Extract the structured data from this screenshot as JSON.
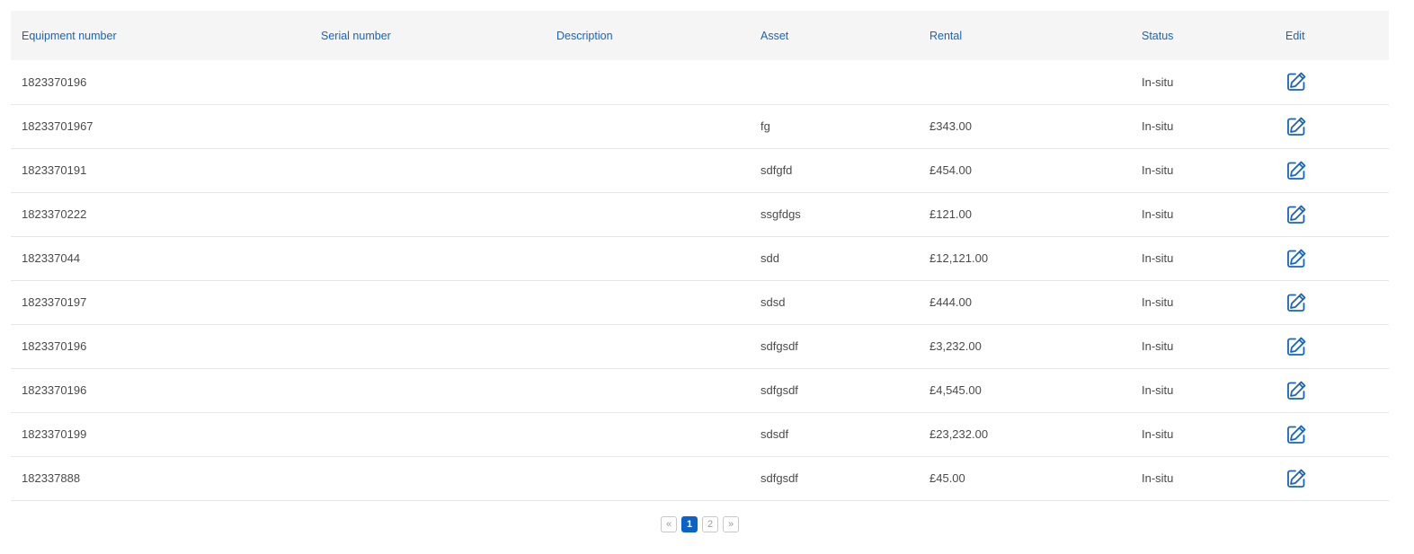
{
  "table": {
    "headers": {
      "equipment_number": "Equipment number",
      "serial_number": "Serial number",
      "description": "Description",
      "asset": "Asset",
      "rental": "Rental",
      "status": "Status",
      "edit": "Edit"
    },
    "rows": [
      {
        "equipment_number": "1823370196",
        "serial_number": "",
        "description": "",
        "asset": "",
        "rental": "",
        "status": "In-situ"
      },
      {
        "equipment_number": "18233701967",
        "serial_number": "",
        "description": "",
        "asset": "fg",
        "rental": "£343.00",
        "status": "In-situ"
      },
      {
        "equipment_number": "1823370191",
        "serial_number": "",
        "description": "",
        "asset": "sdfgfd",
        "rental": "£454.00",
        "status": "In-situ"
      },
      {
        "equipment_number": "1823370222",
        "serial_number": "",
        "description": "",
        "asset": "ssgfdgs",
        "rental": "£121.00",
        "status": "In-situ"
      },
      {
        "equipment_number": "182337044",
        "serial_number": "",
        "description": "",
        "asset": "sdd",
        "rental": "£12,121.00",
        "status": "In-situ"
      },
      {
        "equipment_number": "1823370197",
        "serial_number": "",
        "description": "",
        "asset": "sdsd",
        "rental": "£444.00",
        "status": "In-situ"
      },
      {
        "equipment_number": "1823370196",
        "serial_number": "",
        "description": "",
        "asset": "sdfgsdf",
        "rental": "£3,232.00",
        "status": "In-situ"
      },
      {
        "equipment_number": "1823370196",
        "serial_number": "",
        "description": "",
        "asset": "sdfgsdf",
        "rental": "£4,545.00",
        "status": "In-situ"
      },
      {
        "equipment_number": "1823370199",
        "serial_number": "",
        "description": "",
        "asset": "sdsdf",
        "rental": "£23,232.00",
        "status": "In-situ"
      },
      {
        "equipment_number": "182337888",
        "serial_number": "",
        "description": "",
        "asset": "sdfgsdf",
        "rental": "£45.00",
        "status": "In-situ"
      }
    ],
    "edit_icon": "edit-icon"
  },
  "pagination": {
    "prev_label": "«",
    "pages": [
      "1",
      "2"
    ],
    "current_page": "1",
    "next_label": "»"
  },
  "colors": {
    "header_text": "#1565c0",
    "icon": "#1565c0",
    "active_page": "#0a63c9"
  }
}
